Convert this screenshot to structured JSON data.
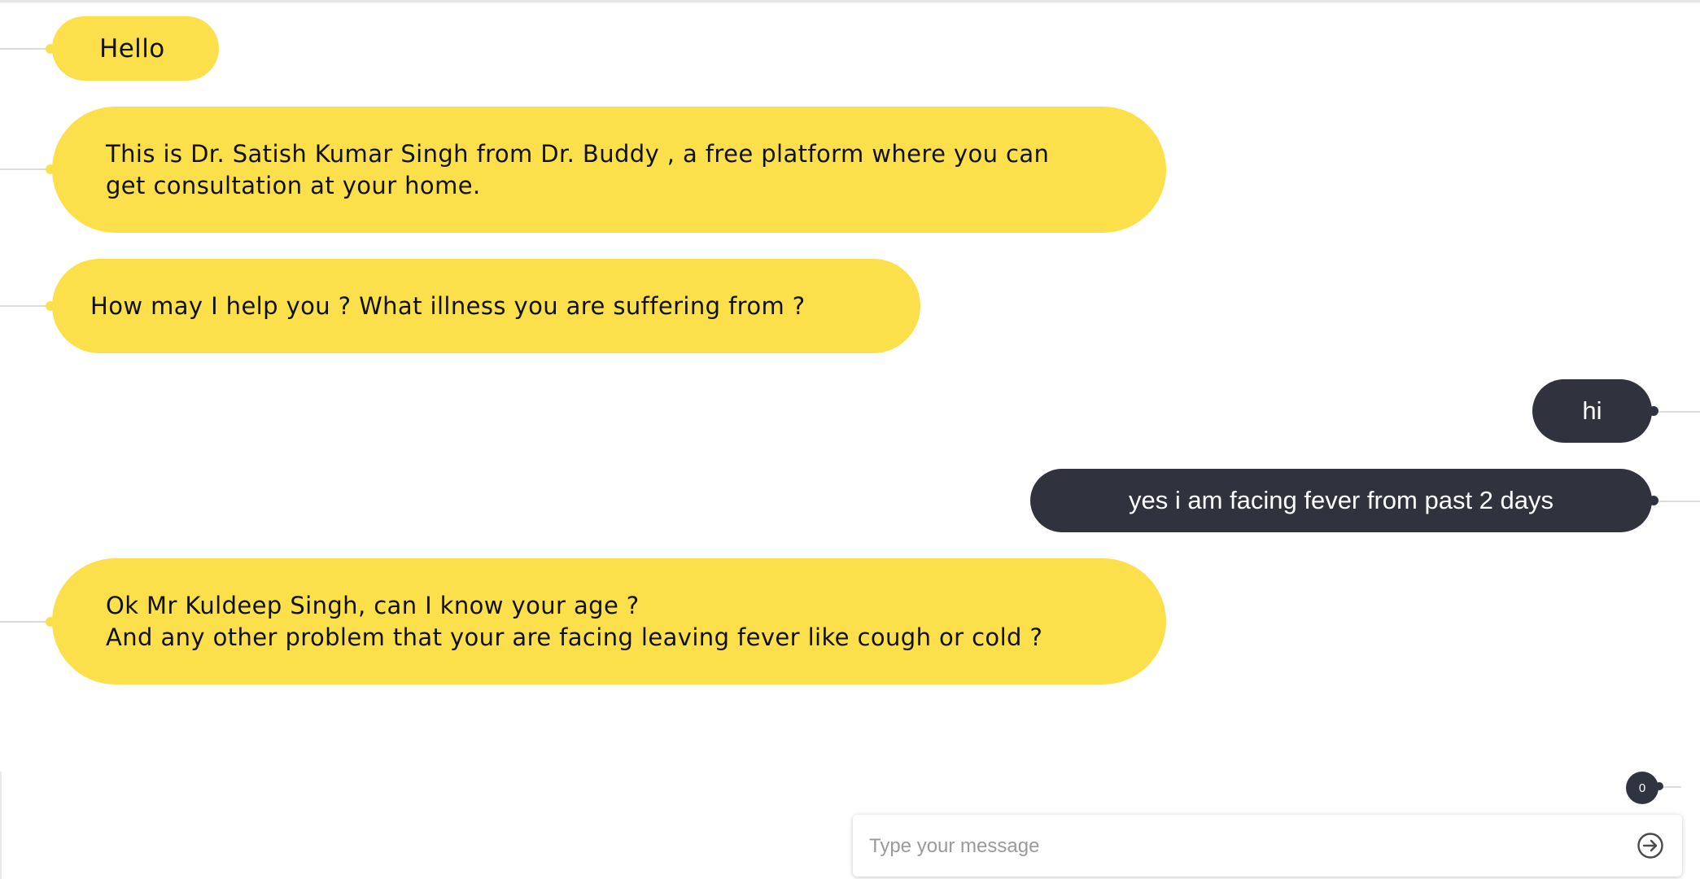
{
  "colors": {
    "bot_bubble": "#fbe04c",
    "user_bubble": "#30333d",
    "badge": "#2f3440"
  },
  "messages": [
    {
      "sender": "bot",
      "lines": [
        "Hello"
      ]
    },
    {
      "sender": "bot",
      "lines": [
        "This is Dr. Satish Kumar Singh from Dr. Buddy , a free platform where you can",
        "get consultation at your home."
      ]
    },
    {
      "sender": "bot",
      "lines": [
        "How may I help you ? What illness you are suffering from ?"
      ]
    },
    {
      "sender": "user",
      "lines": [
        "hi"
      ]
    },
    {
      "sender": "user",
      "lines": [
        "yes i am facing fever from past 2 days"
      ]
    },
    {
      "sender": "bot",
      "lines": [
        "Ok Mr Kuldeep Singh, can I know your age ?",
        "And any other problem that your are facing leaving fever like cough or cold ?"
      ]
    }
  ],
  "unread_badge": {
    "count": "0"
  },
  "composer": {
    "placeholder": "Type your message",
    "value": "",
    "send_icon": "arrow-circle-right-icon"
  }
}
